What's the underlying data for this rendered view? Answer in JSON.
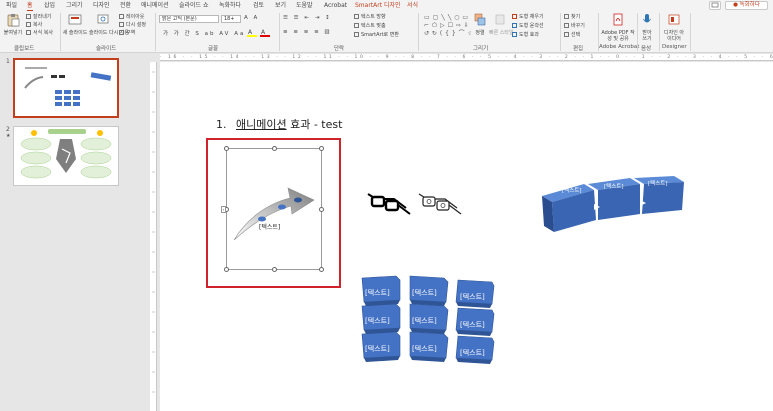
{
  "tabs": [
    "파일",
    "홈",
    "삽입",
    "그리기",
    "디자인",
    "전환",
    "애니메이션",
    "슬라이드 쇼",
    "녹화하다",
    "검토",
    "보기",
    "도움말",
    "Acrobat",
    "SmartArt 디자인",
    "서식"
  ],
  "record_label": "● 녹화하다",
  "ribbon": {
    "paste_label": "붙여넣기",
    "clip_small": [
      "잘라내기",
      "복사",
      "서식 복사"
    ],
    "clip_group": "클립보드",
    "new_slide": "새 슬라이드",
    "reuse_slide": "슬라이드 다시 사용",
    "slide_small": [
      "레이아웃",
      "다시 설정",
      "구역"
    ],
    "slide_group": "슬라이드",
    "font_name": "맑은 고딕 (본문)",
    "font_size": "18+",
    "font_group": "글꼴",
    "para_small": [
      "텍스트 방향",
      "텍스트 맞춤",
      "SmartArt로 변환"
    ],
    "para_group": "단락",
    "draw_group": "그리기",
    "arrange_label": "정렬",
    "quickstyle_label": "빠른 스타일",
    "draw_small": [
      "도형 채우기",
      "도형 윤곽선",
      "도형 효과"
    ],
    "edit_small": [
      "찾기",
      "바꾸기",
      "선택"
    ],
    "edit_group": "편집",
    "adobe_label": "Adobe PDF 작성 및 공유",
    "adobe_group": "Adobe Acrobat",
    "dictate_label": "받아 쓰기",
    "voice_group": "음성",
    "designer_label": "디자인 아이디어",
    "designer_group": "Designer"
  },
  "thumbnails": [
    {
      "number": "1",
      "selected": true
    },
    {
      "number": "2",
      "selected": false,
      "marker": "★"
    }
  ],
  "ruler_text": "· 16 · · 15 · · 14 · · 13 · · 12 · · 11 · · 10 · · 9 · · 8 · · 7 · · 6 · · 5 · · 4 · · 3 · · 2 · · 1 · · 0 · · 1 · · 2 · · 3 · · 4 · · 5 · · 6 · · 7 · · 8 · · 9 · · 10 · · 11 · · 12 · · 13 · · 14 · · 15 · · 16 ·",
  "slide": {
    "title_number": "1.",
    "title_part1": "애니메이션",
    "title_part2": " 효과 - test",
    "arrow_label": "[텍스트]",
    "block_label": "[텍스트]",
    "colors": {
      "block": "#4472c4",
      "block_dark": "#2f5597",
      "select_red": "#d0222a",
      "accent": "#c43e1c"
    }
  }
}
